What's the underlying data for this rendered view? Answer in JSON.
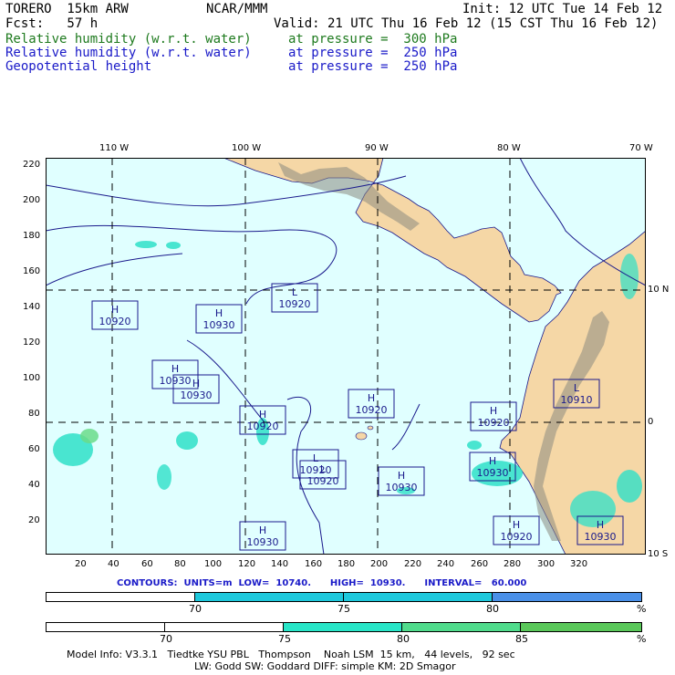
{
  "header": {
    "left1": "TORERO  15km ARW",
    "center1": "NCAR/MMM",
    "right1": "Init: 12 UTC Tue 14 Feb 12",
    "left2": "Fcst:   57 h",
    "right2": "Valid: 21 UTC Thu 16 Feb 12 (15 CST Thu 16 Feb 12)",
    "fields": [
      {
        "name": "Relative humidity (w.r.t. water)",
        "level": "at pressure =  300 hPa",
        "color": "#1e7a1e"
      },
      {
        "name": "Relative humidity (w.r.t. water)",
        "level": "at pressure =  250 hPa",
        "color": "#1a1ac8"
      },
      {
        "name": "Geopotential height",
        "level": "at pressure =  250 hPa",
        "color": "#1a1ac8"
      }
    ]
  },
  "map": {
    "top_lon_labels": [
      "110 W",
      "100 W",
      "90 W",
      "80 W",
      "70 W"
    ],
    "right_lat_labels": [
      "10 N",
      "0",
      "10 S"
    ],
    "y_ticks": [
      "220",
      "200",
      "180",
      "160",
      "140",
      "120",
      "100",
      "80",
      "60",
      "40",
      "20"
    ],
    "x_ticks": [
      "20",
      "40",
      "60",
      "80",
      "100",
      "120",
      "140",
      "160",
      "180",
      "200",
      "220",
      "240",
      "260",
      "280",
      "300",
      "320"
    ],
    "pressure_centers": [
      {
        "type": "H",
        "value": "10920"
      },
      {
        "type": "H",
        "value": "10930"
      },
      {
        "type": "L",
        "value": "10920"
      },
      {
        "type": "H",
        "value": "10930"
      },
      {
        "type": "H",
        "value": "10930"
      },
      {
        "type": "L",
        "value": "10920"
      },
      {
        "type": "H",
        "value": "10920"
      },
      {
        "type": "H",
        "value": "10920"
      },
      {
        "type": "L",
        "value": "10910"
      },
      {
        "type": "H",
        "value": "10920"
      },
      {
        "type": "H",
        "value": "10930"
      },
      {
        "type": "L",
        "value": "10920"
      },
      {
        "type": "H",
        "value": "10930"
      },
      {
        "type": "H",
        "value": "10920"
      },
      {
        "type": "H",
        "value": "10930"
      },
      {
        "type": "H",
        "value": "10930"
      }
    ],
    "colors": {
      "ocean": "#e0ffff",
      "land": "#f5d7a6",
      "mountain": "#8a8a80",
      "contour": "#1a1a8c",
      "grid": "#000000"
    }
  },
  "contours_text": "CONTOURS:  UNITS=m  LOW=  10740.      HIGH=  10930.      INTERVAL=   60.000",
  "colorbar1": {
    "ticks": [
      "70",
      "75",
      "80"
    ],
    "unit": "%",
    "colors": [
      "#ffffff",
      "#ffffff",
      "#1ec8dc",
      "#1ec8dc",
      "#4a90e8"
    ]
  },
  "colorbar2": {
    "ticks": [
      "70",
      "75",
      "80",
      "85"
    ],
    "unit": "%",
    "colors": [
      "#ffffff",
      "#ffffff",
      "#28e6c8",
      "#50dc8c",
      "#5ac85a"
    ]
  },
  "footer": {
    "line1": "Model Info: V3.3.1   Tiedtke YSU PBL   Thompson    Noah LSM  15 km,   44 levels,   92 sec",
    "line2": "LW: Godd SW: Goddard DIFF: simple KM: 2D Smagor"
  }
}
